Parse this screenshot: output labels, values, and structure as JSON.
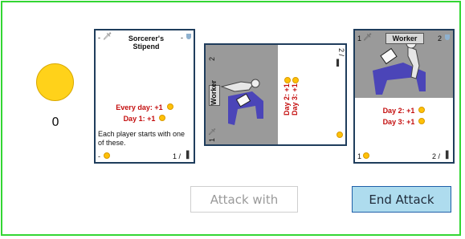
{
  "player": {
    "coins": "0"
  },
  "card1": {
    "title": "Sorcerer's Stipend",
    "top_left": "-",
    "top_right": "-",
    "line_every_day": "Every day: +1",
    "line_day1": "Day 1: +1",
    "description": "Each player starts with one of these.",
    "bottom_left": "-",
    "bottom_right": "1 /"
  },
  "card2": {
    "title": "Worker",
    "top_left": "2",
    "top_right": "2 /",
    "line_day2": "Day 2: +1",
    "line_day3": "Day 3: +1",
    "bottom_left": "1"
  },
  "card3": {
    "title": "Worker",
    "top_left": "1",
    "top_right": "2",
    "line_day2": "Day 2: +1",
    "line_day3": "Day 3: +1",
    "bottom_left": "1",
    "bottom_right": "2 /"
  },
  "buttons": {
    "attack": "Attack with",
    "end": "End Attack"
  },
  "colors": {
    "border": "#33d633",
    "coin": "#ffd21a",
    "end_button_bg": "#aedcee"
  }
}
